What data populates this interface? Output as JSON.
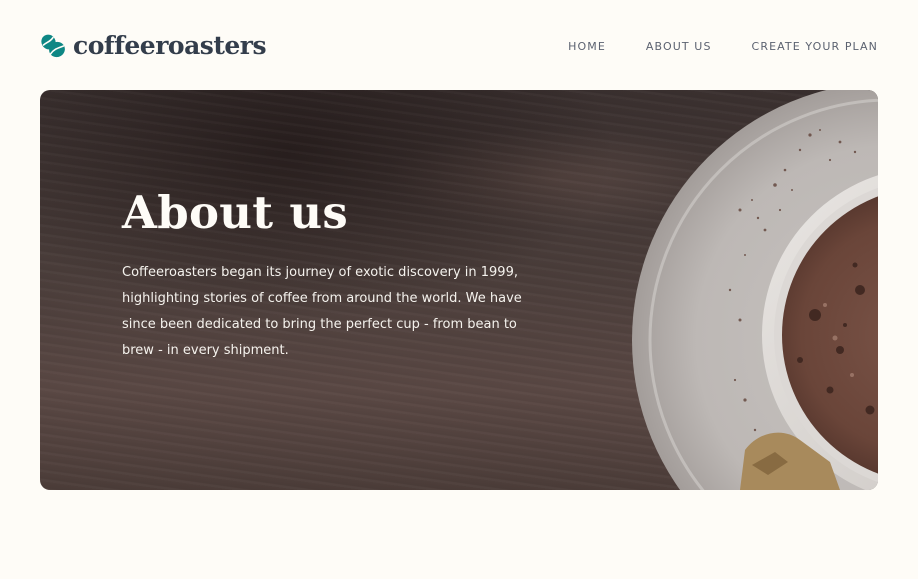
{
  "header": {
    "logo_text": "coffeeroasters",
    "logo_icon": "coffee-bean-icon",
    "nav": [
      {
        "label": "HOME"
      },
      {
        "label": "ABOUT US"
      },
      {
        "label": "CREATE YOUR PLAN"
      }
    ]
  },
  "hero": {
    "title": "About us",
    "text": "Coffeeroasters began its journey of exotic discovery in 1999,\nhighlighting stories of  coffee from around the world. We have\nsince been dedicated to bring the perfect cup - from  bean to\nbrew - in every shipment.",
    "image": "coffee-cup-on-wooden-table"
  },
  "colors": {
    "background": "#FEFCF7",
    "brand_dark": "#333D4B",
    "brand_accent": "#0E8784",
    "nav_text": "#5C6270",
    "hero_text": "#FEFCF7"
  }
}
